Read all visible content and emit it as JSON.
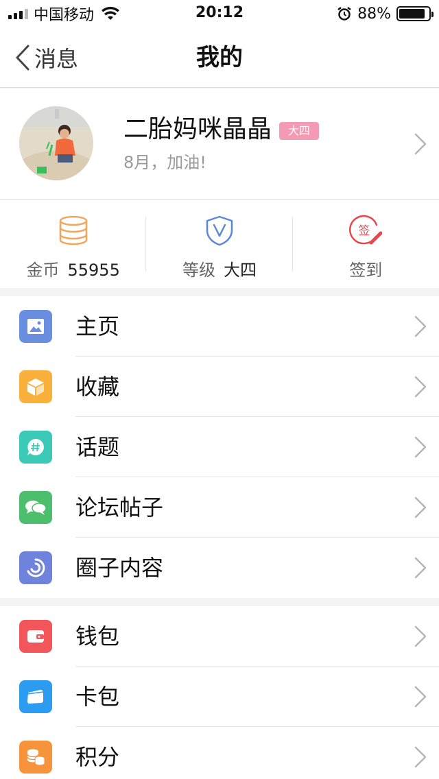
{
  "status_bar": {
    "carrier": "中国移动",
    "time": "20:12",
    "battery": "88%",
    "battery_level": 0.88
  },
  "nav": {
    "back_label": "消息",
    "title": "我的"
  },
  "profile": {
    "name": "二胎妈咪晶晶",
    "level_badge": "大四",
    "subtitle": "8月，加油!"
  },
  "stats": {
    "coins_label": "金币",
    "coins_value": "55955",
    "level_label": "等级",
    "level_value": "大四",
    "signin_label": "签到",
    "signin_icon_text": "签"
  },
  "menu_group_1": {
    "items": [
      {
        "label": "主页",
        "icon": "image-icon",
        "color": "#6a8ee0"
      },
      {
        "label": "收藏",
        "icon": "box-icon",
        "color": "#f9b13c"
      },
      {
        "label": "话题",
        "icon": "hashtag-chat-icon",
        "color": "#3ccab8"
      },
      {
        "label": "论坛帖子",
        "icon": "chat-bubbles-icon",
        "color": "#4dbf6c"
      },
      {
        "label": "圈子内容",
        "icon": "circle-swirl-icon",
        "color": "#6f83dd"
      }
    ]
  },
  "menu_group_2": {
    "items": [
      {
        "label": "钱包",
        "icon": "wallet-icon",
        "color": "#f2555a"
      },
      {
        "label": "卡包",
        "icon": "card-icon",
        "color": "#2b9cf0"
      },
      {
        "label": "积分",
        "icon": "coins-stack-icon",
        "color": "#f7933b"
      }
    ]
  },
  "colors": {
    "coin_icon": "#f2a55c",
    "level_icon": "#5b87d8",
    "signin_icon": "#e8474e",
    "badge": "#f59ab5"
  }
}
